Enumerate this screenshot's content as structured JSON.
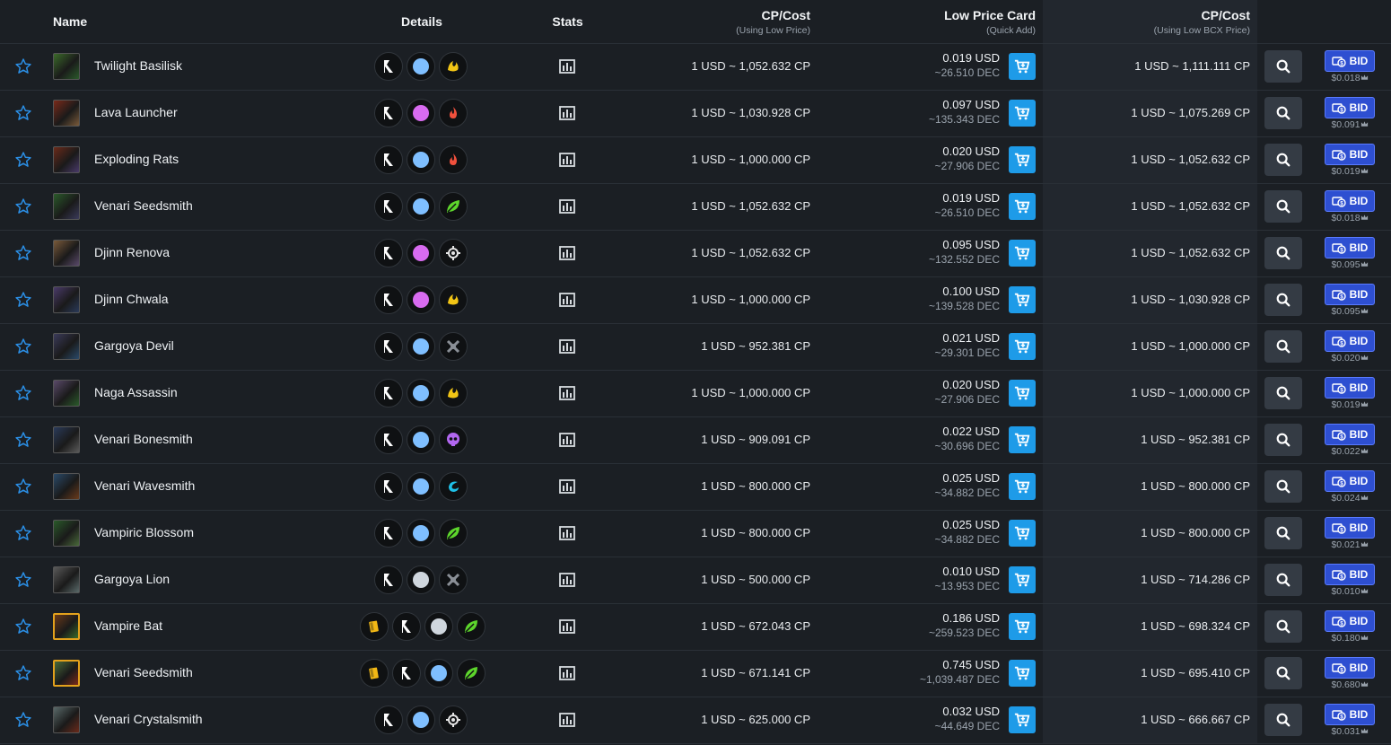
{
  "header": {
    "name": "Name",
    "details": "Details",
    "stats": "Stats",
    "cp_cost": "CP/Cost",
    "cp_cost_sub": "(Using Low Price)",
    "low_price": "Low Price Card",
    "low_price_sub": "(Quick Add)",
    "bcx_cost": "CP/Cost",
    "bcx_cost_sub": "(Using Low BCX Price)"
  },
  "bid_label": "BID",
  "colors": {
    "accent": "#1e9be8",
    "bid": "#2e4fd1",
    "gold": "#e3a11c"
  },
  "rows": [
    {
      "name": "Twilight Basilisk",
      "foil": false,
      "rarity": "#7fbfff",
      "element": "earth",
      "cp": "1 USD ~ 1,052.632 CP",
      "usd": "0.019 USD",
      "dec": "~26.510 DEC",
      "bcx": "1 USD ~ 1,111.111 CP",
      "bid": "$0.018"
    },
    {
      "name": "Lava Launcher",
      "foil": false,
      "rarity": "#d86bf0",
      "element": "fire",
      "cp": "1 USD ~ 1,030.928 CP",
      "usd": "0.097 USD",
      "dec": "~135.343 DEC",
      "bcx": "1 USD ~ 1,075.269 CP",
      "bid": "$0.091"
    },
    {
      "name": "Exploding Rats",
      "foil": false,
      "rarity": "#7fbfff",
      "element": "fire",
      "cp": "1 USD ~ 1,000.000 CP",
      "usd": "0.020 USD",
      "dec": "~27.906 DEC",
      "bcx": "1 USD ~ 1,052.632 CP",
      "bid": "$0.019"
    },
    {
      "name": "Venari Seedsmith",
      "foil": false,
      "rarity": "#7fbfff",
      "element": "nature",
      "cp": "1 USD ~ 1,052.632 CP",
      "usd": "0.019 USD",
      "dec": "~26.510 DEC",
      "bcx": "1 USD ~ 1,052.632 CP",
      "bid": "$0.018"
    },
    {
      "name": "Djinn Renova",
      "foil": false,
      "rarity": "#d86bf0",
      "element": "neutral",
      "cp": "1 USD ~ 1,052.632 CP",
      "usd": "0.095 USD",
      "dec": "~132.552 DEC",
      "bcx": "1 USD ~ 1,052.632 CP",
      "bid": "$0.095"
    },
    {
      "name": "Djinn Chwala",
      "foil": false,
      "rarity": "#d86bf0",
      "element": "earth",
      "cp": "1 USD ~ 1,000.000 CP",
      "usd": "0.100 USD",
      "dec": "~139.528 DEC",
      "bcx": "1 USD ~ 1,030.928 CP",
      "bid": "$0.095"
    },
    {
      "name": "Gargoya Devil",
      "foil": false,
      "rarity": "#7fbfff",
      "element": "dragon",
      "cp": "1 USD ~ 952.381 CP",
      "usd": "0.021 USD",
      "dec": "~29.301 DEC",
      "bcx": "1 USD ~ 1,000.000 CP",
      "bid": "$0.020"
    },
    {
      "name": "Naga Assassin",
      "foil": false,
      "rarity": "#7fbfff",
      "element": "earth",
      "cp": "1 USD ~ 1,000.000 CP",
      "usd": "0.020 USD",
      "dec": "~27.906 DEC",
      "bcx": "1 USD ~ 1,000.000 CP",
      "bid": "$0.019"
    },
    {
      "name": "Venari Bonesmith",
      "foil": false,
      "rarity": "#7fbfff",
      "element": "death",
      "cp": "1 USD ~ 909.091 CP",
      "usd": "0.022 USD",
      "dec": "~30.696 DEC",
      "bcx": "1 USD ~ 952.381 CP",
      "bid": "$0.022"
    },
    {
      "name": "Venari Wavesmith",
      "foil": false,
      "rarity": "#7fbfff",
      "element": "water",
      "cp": "1 USD ~ 800.000 CP",
      "usd": "0.025 USD",
      "dec": "~34.882 DEC",
      "bcx": "1 USD ~ 800.000 CP",
      "bid": "$0.024"
    },
    {
      "name": "Vampiric Blossom",
      "foil": false,
      "rarity": "#7fbfff",
      "element": "nature",
      "cp": "1 USD ~ 800.000 CP",
      "usd": "0.025 USD",
      "dec": "~34.882 DEC",
      "bcx": "1 USD ~ 800.000 CP",
      "bid": "$0.021"
    },
    {
      "name": "Gargoya Lion",
      "foil": false,
      "rarity": "#cfd6dd",
      "element": "dragon",
      "cp": "1 USD ~ 500.000 CP",
      "usd": "0.010 USD",
      "dec": "~13.953 DEC",
      "bcx": "1 USD ~ 714.286 CP",
      "bid": "$0.010"
    },
    {
      "name": "Vampire Bat",
      "foil": true,
      "rarity": "#cfd6dd",
      "element": "nature",
      "cp": "1 USD ~ 672.043 CP",
      "usd": "0.186 USD",
      "dec": "~259.523 DEC",
      "bcx": "1 USD ~ 698.324 CP",
      "bid": "$0.180"
    },
    {
      "name": "Venari Seedsmith",
      "foil": true,
      "rarity": "#7fbfff",
      "element": "nature",
      "cp": "1 USD ~ 671.141 CP",
      "usd": "0.745 USD",
      "dec": "~1,039.487 DEC",
      "bcx": "1 USD ~ 695.410 CP",
      "bid": "$0.680"
    },
    {
      "name": "Venari Crystalsmith",
      "foil": false,
      "rarity": "#7fbfff",
      "element": "neutral",
      "cp": "1 USD ~ 625.000 CP",
      "usd": "0.032 USD",
      "dec": "~44.649 DEC",
      "bcx": "1 USD ~ 666.667 CP",
      "bid": "$0.031"
    }
  ]
}
